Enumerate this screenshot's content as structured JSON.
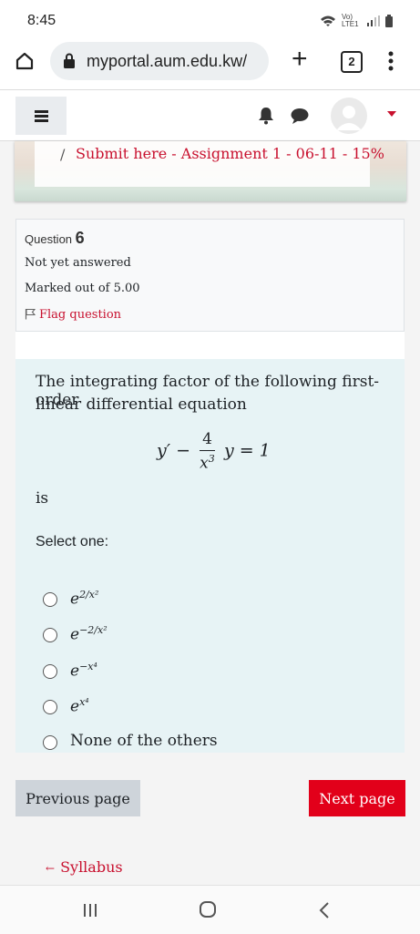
{
  "status_bar": {
    "time": "8:45",
    "network": "Vo) LTE1"
  },
  "browser": {
    "url": "myportal.aum.edu.kw/",
    "tab_count": "2"
  },
  "breadcrumb": {
    "separator": "/",
    "link": "Submit here - Assignment 1 - 06-11 - 15%"
  },
  "info": {
    "question_label": "Question",
    "question_number": "6",
    "status": "Not yet answered",
    "marked": "Marked out of 5.00",
    "flag": "Flag question"
  },
  "question": {
    "line1": "The integrating factor of the following first-order",
    "line2": "linear differential equation",
    "formula": {
      "lhs": "y′ −",
      "num": "4",
      "den_base": "x",
      "den_exp": "3",
      "rhs": "y = 1"
    },
    "is": "is",
    "select_one": "Select one:",
    "options": [
      {
        "base": "e",
        "exp": "2/x²"
      },
      {
        "base": "e",
        "exp": "−2/x²"
      },
      {
        "base": "e",
        "exp": "−x⁴"
      },
      {
        "base": "e",
        "exp": "x⁴"
      },
      {
        "text": "None of the others"
      }
    ]
  },
  "nav": {
    "previous": "Previous page",
    "next": "Next page",
    "syllabus": "Syllabus"
  },
  "colors": {
    "accent": "#c8102e",
    "next_button": "#e2001a",
    "question_bg": "#e7f3f5"
  }
}
